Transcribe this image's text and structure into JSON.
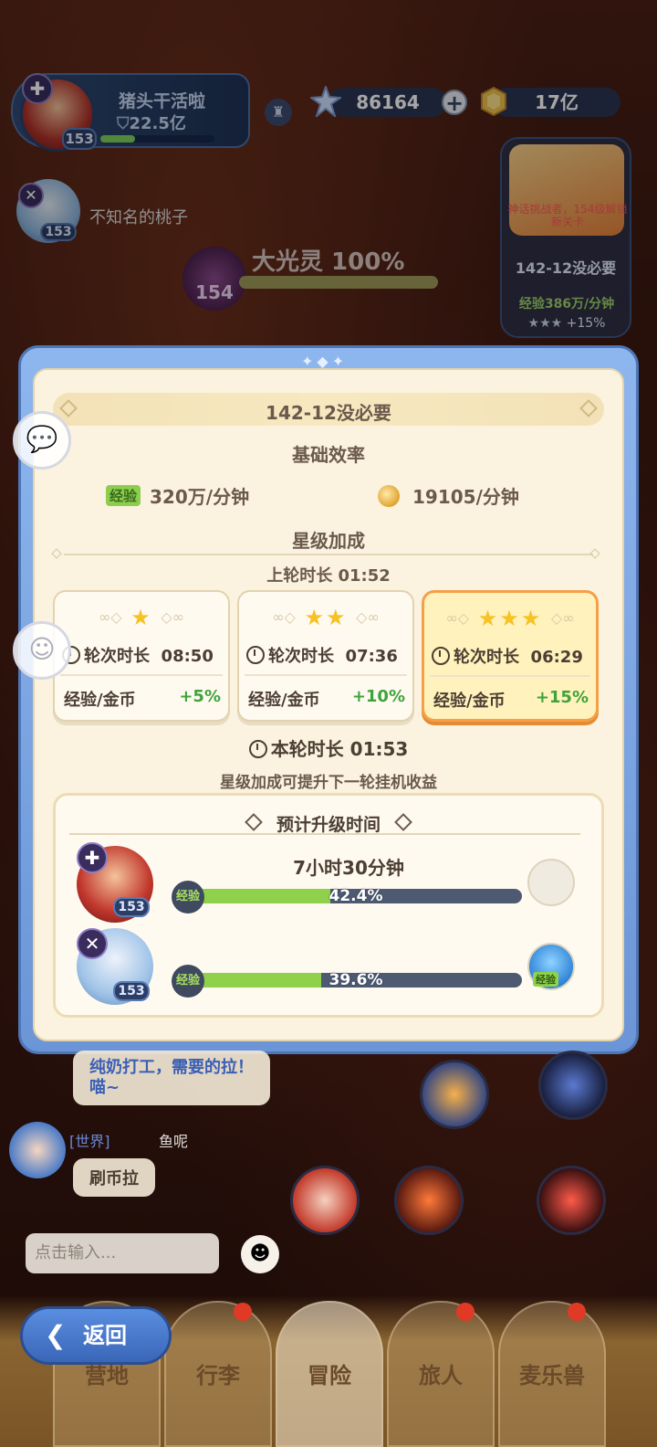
{
  "player": {
    "name": "猪头干活啦",
    "power": "22.5亿",
    "level": "153"
  },
  "currencies": {
    "gems": "86164",
    "gold": "17亿"
  },
  "companion": {
    "name": "不知名的桃子",
    "level": "153"
  },
  "boss": {
    "label": "大光灵 100%",
    "level": "154"
  },
  "side_stage": {
    "caption": "神话挑战者，154级解锁新关卡",
    "stage_name": "142-12没必要",
    "exp_rate": "经验386万/分钟",
    "bonus": "+15%"
  },
  "modal": {
    "stage_title": "142-12没必要",
    "base_efficiency_title": "基础效率",
    "exp_tag": "经验",
    "exp_rate": "320万/分钟",
    "gold_rate": "19105/分钟",
    "star_bonus_title": "星级加成",
    "last_round": "上轮时长  01:52",
    "star_cards": [
      {
        "stars": "★",
        "round_label": "轮次时长",
        "round_time": "08:50",
        "bonus_label": "经验/金币",
        "bonus": "+5%"
      },
      {
        "stars": "★★",
        "round_label": "轮次时长",
        "round_time": "07:36",
        "bonus_label": "经验/金币",
        "bonus": "+10%"
      },
      {
        "stars": "★★★",
        "round_label": "轮次时长",
        "round_time": "06:29",
        "bonus_label": "经验/金币",
        "bonus": "+15%"
      }
    ],
    "current_round": "本轮时长  01:53",
    "hint": "星级加成可提升下一轮挂机收益",
    "upgrade_title": "预计升级时间",
    "heroes": [
      {
        "level": "153",
        "time_left": "7小时30分钟",
        "exp_tag": "经验",
        "progress_label": "42.4%",
        "progress": 0.424
      },
      {
        "level": "153",
        "time_left": "",
        "exp_tag": "经验",
        "progress_label": "39.6%",
        "progress": 0.396
      }
    ],
    "potion_tag": "经验"
  },
  "chat": {
    "bubble1": "纯奶打工，需要的拉！喵~",
    "world_tag": "[世界]",
    "user": "鱼呢",
    "bubble2": "刷币拉",
    "input_placeholder": "点击输入..."
  },
  "nav": {
    "back": "返回",
    "items": [
      "营地",
      "行李",
      "冒险",
      "旅人",
      "麦乐兽"
    ]
  },
  "colors": {
    "modal_frame": "#6b95d6",
    "panel_bg": "#fbf3df",
    "progress_green": "#8fd14a",
    "bonus_green": "#3fa33b",
    "active_card_border": "#f5a047"
  }
}
